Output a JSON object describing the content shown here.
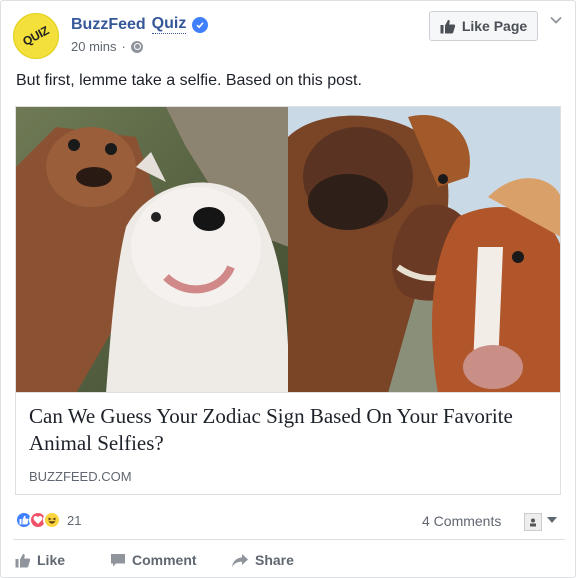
{
  "header": {
    "avatar_text": "QUIZ",
    "page_name_part1": "BuzzFeed",
    "page_name_part2": "Quiz",
    "time": "20 mins",
    "separator": "·",
    "like_page_label": "Like Page"
  },
  "post": {
    "text": "But first, lemme take a selfie. Based on this post."
  },
  "link": {
    "title": "Can We Guess Your Zodiac Sign Based On Your Favorite Animal Selfies?",
    "domain": "BUZZFEED.COM"
  },
  "engagement": {
    "reaction_count": "21",
    "comments_label": "4 Comments"
  },
  "actions": {
    "like": "Like",
    "comment": "Comment",
    "share": "Share"
  },
  "colors": {
    "link_blue": "#365899",
    "like_blue": "#4080ff",
    "love_red": "#f25268",
    "haha_yellow": "#fcd53f",
    "avatar_yellow": "#f3e03a",
    "text_gray": "#606770"
  },
  "icons": [
    "verified-badge-icon",
    "globe-icon",
    "like-thumb-icon",
    "chevron-down-icon",
    "like-reaction-icon",
    "love-reaction-icon",
    "haha-reaction-icon",
    "comment-icon",
    "share-icon"
  ]
}
